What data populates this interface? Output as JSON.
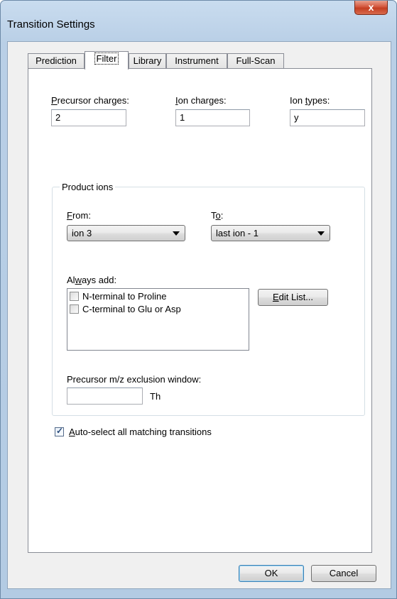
{
  "window": {
    "title": "Transition Settings",
    "close_glyph": "x"
  },
  "tabs": [
    {
      "label": "Prediction",
      "active": false
    },
    {
      "label": "Filter",
      "active": true
    },
    {
      "label": "Library",
      "active": false
    },
    {
      "label": "Instrument",
      "active": false
    },
    {
      "label": "Full-Scan",
      "active": false
    }
  ],
  "filter": {
    "precursor_charges": {
      "label_u": "P",
      "label_rest": "recursor charges:",
      "value": "2"
    },
    "ion_charges": {
      "label_u": "I",
      "label_rest": "on charges:",
      "value": "1"
    },
    "ion_types": {
      "label_pre": "Ion ",
      "label_u": "t",
      "label_rest": "ypes:",
      "value": "y"
    },
    "product_ions": {
      "group_label": "Product ions",
      "from": {
        "label_u": "F",
        "label_rest": "rom:",
        "value": "ion 3"
      },
      "to": {
        "label_pre": "T",
        "label_u": "o",
        "label_rest": ":",
        "value": "last ion - 1"
      },
      "always_add": {
        "label_pre": "Al",
        "label_u": "w",
        "label_rest": "ays add:",
        "items": [
          {
            "label": "N-terminal to Proline",
            "checked": false
          },
          {
            "label": "C-terminal to Glu or Asp",
            "checked": false
          }
        ]
      },
      "edit_list": {
        "label_u": "E",
        "label_rest": "dit List..."
      },
      "exclusion": {
        "label": "Precursor m/z exclusion window:",
        "value": "",
        "unit": "Th"
      }
    },
    "auto_select": {
      "label_u": "A",
      "label_rest": "uto-select all matching transitions",
      "checked": true
    }
  },
  "buttons": {
    "ok": "OK",
    "cancel": "Cancel"
  },
  "colors": {
    "frame": "#b9cfe6",
    "close": "#c43e22",
    "check": "#2a4b7a"
  }
}
